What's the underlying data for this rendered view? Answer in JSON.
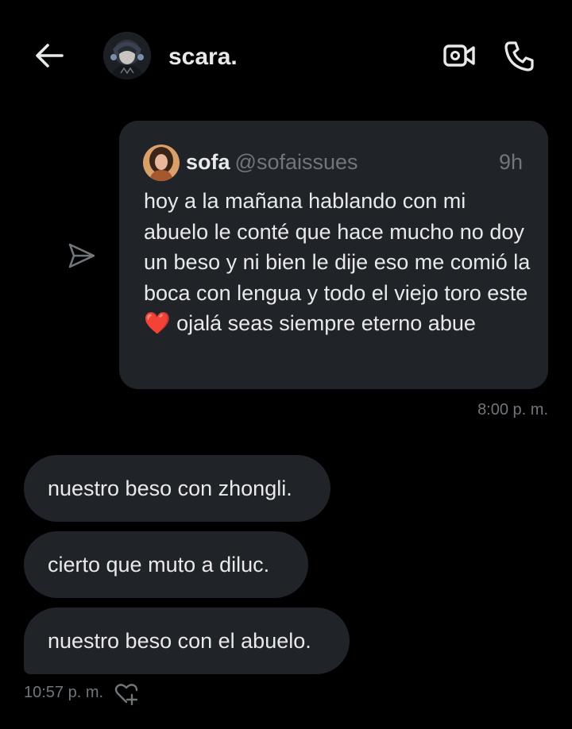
{
  "header": {
    "back_icon": "arrow-left-icon",
    "chat_name": "scara.",
    "video_icon": "video-camera-icon",
    "call_icon": "phone-icon"
  },
  "shared_tweet": {
    "share_icon": "send-icon",
    "author_name": "sofa",
    "author_handle": "@sofaissues",
    "time_ago": "9h",
    "text_before_emoji": "hoy a la mañana hablando con mi abuelo le conté que hace mucho no doy un beso y ni bien le dije eso me comió la boca con lengua y todo el viejo toro este ",
    "emoji": "❤️",
    "text_after_emoji": " ojalá seas siempre eterno abue",
    "sent_time": "8:00 p. m."
  },
  "received_messages": [
    {
      "text": "nuestro beso con zhongli."
    },
    {
      "text": "cierto que muto a diluc."
    },
    {
      "text": "nuestro beso con el abuelo."
    }
  ],
  "received_time": "10:57 p. m.",
  "react_icon": "heart-plus-icon",
  "colors": {
    "background": "#000000",
    "bubble": "#202327",
    "text": "#e7e9ea",
    "muted": "#71767b",
    "heart": "#f0243a"
  }
}
